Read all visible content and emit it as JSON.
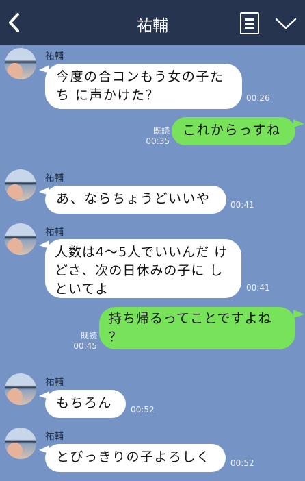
{
  "header": {
    "title": "祐輔"
  },
  "messages": [
    {
      "side": "in",
      "sender": "祐輔",
      "text": "今度の合コンもう女の子たち に声かけた？",
      "time": "00:26"
    },
    {
      "side": "out",
      "read": "既読",
      "text": "これからっすね",
      "time": "00:35"
    },
    {
      "side": "in",
      "sender": "祐輔",
      "text": "あ、ならちょうどいいや",
      "time": "00:41"
    },
    {
      "side": "in",
      "sender": "祐輔",
      "text": "人数は4〜5人でいいんだ けどさ、次の日休みの子に しといてよ",
      "time": "00:41"
    },
    {
      "side": "out",
      "read": "既読",
      "text": "持ち帰るってことですよね ？",
      "time": "00:45"
    },
    {
      "side": "in",
      "sender": "祐輔",
      "text": "もちろん",
      "time": "00:52"
    },
    {
      "side": "in",
      "sender": "祐輔",
      "text": "とびっきりの子よろしく",
      "time": "00:52"
    }
  ]
}
